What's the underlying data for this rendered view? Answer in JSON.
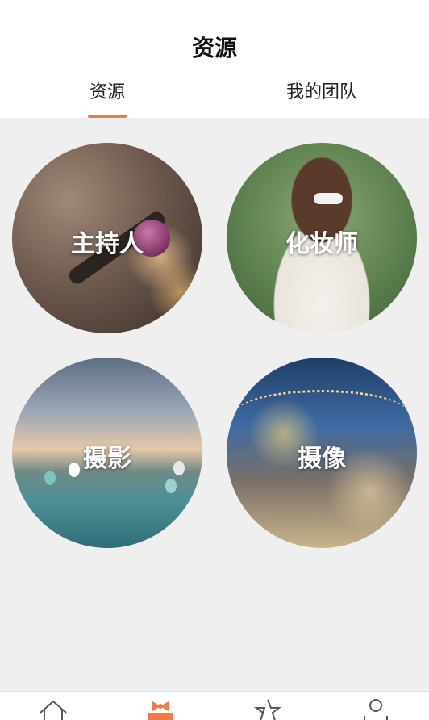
{
  "header": {
    "title": "资源"
  },
  "tabs": [
    {
      "label": "资源",
      "active": true
    },
    {
      "label": "我的团队",
      "active": false
    }
  ],
  "accent_color": "#f07a4a",
  "resources": [
    {
      "label": "主持人"
    },
    {
      "label": "化妆师"
    },
    {
      "label": "摄影"
    },
    {
      "label": "摄像"
    }
  ],
  "bottom_nav": [
    {
      "icon": "home-icon"
    },
    {
      "icon": "resource-bow-icon",
      "active": true
    },
    {
      "icon": "star-icon"
    },
    {
      "icon": "user-icon"
    }
  ]
}
